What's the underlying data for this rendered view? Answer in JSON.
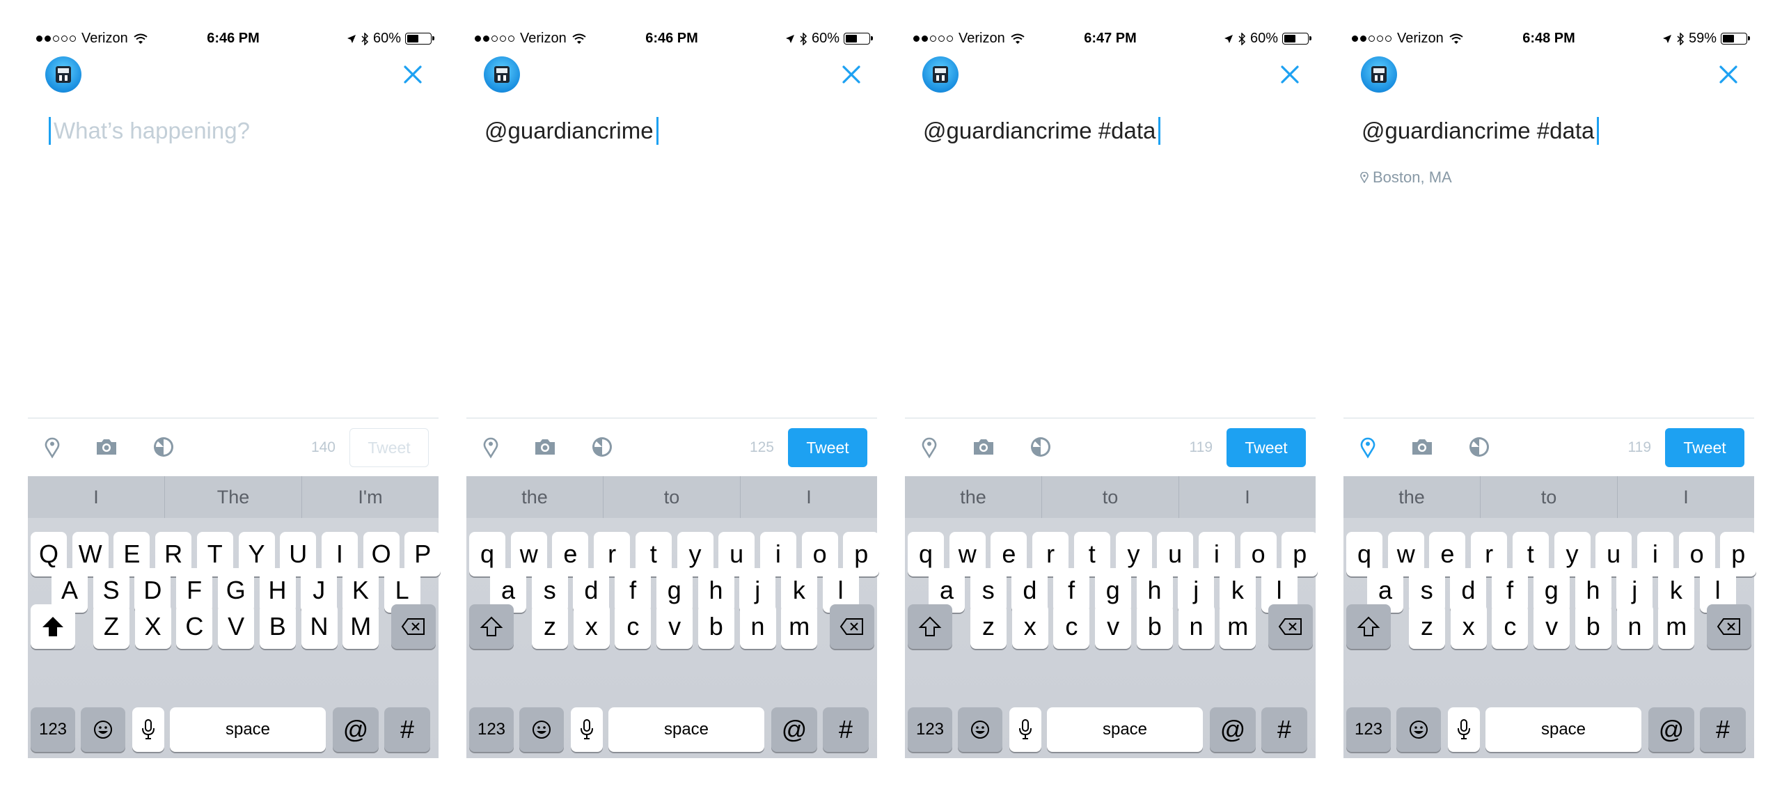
{
  "panels": [
    {
      "status": {
        "carrier": "Verizon",
        "time": "6:46 PM",
        "battery": "60%",
        "battery_level": 0.6
      },
      "compose": {
        "text": "",
        "placeholder": "What’s happening?",
        "location": ""
      },
      "toolbar": {
        "counter": "140",
        "tweet_label": "Tweet",
        "tweet_enabled": false,
        "location_active": false
      },
      "suggestions": [
        "I",
        "The",
        "I'm"
      ],
      "keys": {
        "row1": [
          "Q",
          "W",
          "E",
          "R",
          "T",
          "Y",
          "U",
          "I",
          "O",
          "P"
        ],
        "row2": [
          "A",
          "S",
          "D",
          "F",
          "G",
          "H",
          "J",
          "K",
          "L"
        ],
        "row3": [
          "Z",
          "X",
          "C",
          "V",
          "B",
          "N",
          "M"
        ],
        "shift_active": true,
        "numbers": "123",
        "space": "space",
        "at": "@",
        "hash": "#"
      }
    },
    {
      "status": {
        "carrier": "Verizon",
        "time": "6:46 PM",
        "battery": "60%",
        "battery_level": 0.6
      },
      "compose": {
        "text": "@guardiancrime",
        "placeholder": "",
        "location": ""
      },
      "toolbar": {
        "counter": "125",
        "tweet_label": "Tweet",
        "tweet_enabled": true,
        "location_active": false
      },
      "suggestions": [
        "the",
        "to",
        "I"
      ],
      "keys": {
        "row1": [
          "q",
          "w",
          "e",
          "r",
          "t",
          "y",
          "u",
          "i",
          "o",
          "p"
        ],
        "row2": [
          "a",
          "s",
          "d",
          "f",
          "g",
          "h",
          "j",
          "k",
          "l"
        ],
        "row3": [
          "z",
          "x",
          "c",
          "v",
          "b",
          "n",
          "m"
        ],
        "shift_active": false,
        "numbers": "123",
        "space": "space",
        "at": "@",
        "hash": "#"
      }
    },
    {
      "status": {
        "carrier": "Verizon",
        "time": "6:47 PM",
        "battery": "60%",
        "battery_level": 0.6
      },
      "compose": {
        "text": "@guardiancrime #data",
        "placeholder": "",
        "location": ""
      },
      "toolbar": {
        "counter": "119",
        "tweet_label": "Tweet",
        "tweet_enabled": true,
        "location_active": false
      },
      "suggestions": [
        "the",
        "to",
        "I"
      ],
      "keys": {
        "row1": [
          "q",
          "w",
          "e",
          "r",
          "t",
          "y",
          "u",
          "i",
          "o",
          "p"
        ],
        "row2": [
          "a",
          "s",
          "d",
          "f",
          "g",
          "h",
          "j",
          "k",
          "l"
        ],
        "row3": [
          "z",
          "x",
          "c",
          "v",
          "b",
          "n",
          "m"
        ],
        "shift_active": false,
        "numbers": "123",
        "space": "space",
        "at": "@",
        "hash": "#"
      }
    },
    {
      "status": {
        "carrier": "Verizon",
        "time": "6:48 PM",
        "battery": "59%",
        "battery_level": 0.59
      },
      "compose": {
        "text": "@guardiancrime #data",
        "placeholder": "",
        "location": "Boston, MA"
      },
      "toolbar": {
        "counter": "119",
        "tweet_label": "Tweet",
        "tweet_enabled": true,
        "location_active": true
      },
      "suggestions": [
        "the",
        "to",
        "I"
      ],
      "keys": {
        "row1": [
          "q",
          "w",
          "e",
          "r",
          "t",
          "y",
          "u",
          "i",
          "o",
          "p"
        ],
        "row2": [
          "a",
          "s",
          "d",
          "f",
          "g",
          "h",
          "j",
          "k",
          "l"
        ],
        "row3": [
          "z",
          "x",
          "c",
          "v",
          "b",
          "n",
          "m"
        ],
        "shift_active": false,
        "numbers": "123",
        "space": "space",
        "at": "@",
        "hash": "#"
      }
    }
  ],
  "colors": {
    "accent": "#1da1f2",
    "icon_gray": "#8899a6",
    "counter_gray": "#bcc8d2"
  }
}
